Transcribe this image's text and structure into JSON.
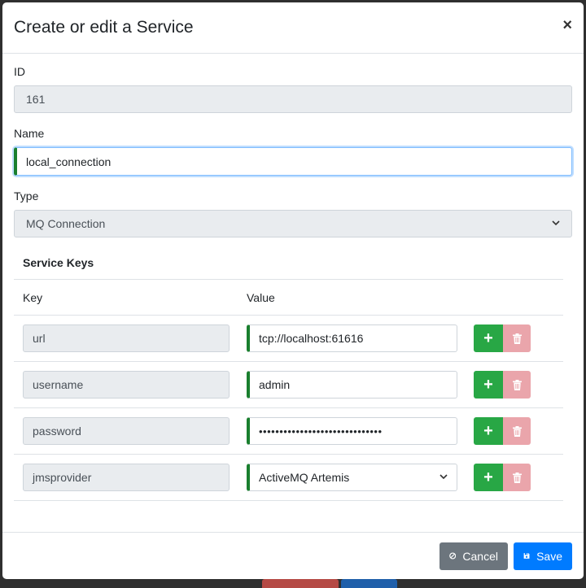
{
  "modal": {
    "title": "Create or edit a Service",
    "close_label": "×"
  },
  "form": {
    "id_label": "ID",
    "id_value": "161",
    "name_label": "Name",
    "name_value": "local_connection",
    "type_label": "Type",
    "type_value": "MQ Connection"
  },
  "service_keys": {
    "heading": "Service Keys",
    "col_key": "Key",
    "col_value": "Value",
    "rows": [
      {
        "key": "url",
        "value": "tcp://localhost:61616"
      },
      {
        "key": "username",
        "value": "admin"
      },
      {
        "key": "password",
        "value": "••••••••••••••••••••••••••••••"
      },
      {
        "key": "jmsprovider",
        "value": "ActiveMQ Artemis"
      }
    ],
    "add_symbol": "+"
  },
  "footer": {
    "cancel_label": "Cancel",
    "save_label": "Save"
  },
  "colors": {
    "success": "#28a745",
    "danger_disabled": "#eaa5ab",
    "primary": "#007bff",
    "secondary": "#6c757d",
    "valid_border": "#1a7f2e"
  },
  "icons": {
    "close": "close-icon",
    "add": "plus-icon",
    "delete": "trash-icon",
    "cancel": "ban-icon",
    "save": "save-icon",
    "select": "chevron-down-icon"
  }
}
